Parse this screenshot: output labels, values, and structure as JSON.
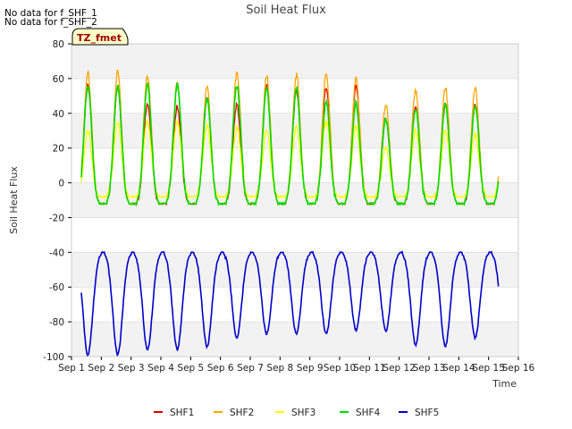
{
  "notes": [
    "No data for f_SHF_1",
    "No data for f_SHF_2"
  ],
  "badge": "TZ_fmet",
  "chart_data": {
    "type": "line",
    "title": "Soil Heat Flux",
    "xlabel": "Time",
    "ylabel": "Soil Heat Flux",
    "xlim": [
      1,
      16
    ],
    "ylim": [
      -100,
      80
    ],
    "x_ticks": [
      1,
      2,
      3,
      4,
      5,
      6,
      7,
      8,
      9,
      10,
      11,
      12,
      13,
      14,
      15,
      16
    ],
    "x_tick_labels": [
      "Sep 1",
      "Sep 2",
      "Sep 3",
      "Sep 4",
      "Sep 5",
      "Sep 6",
      "Sep 7",
      "Sep 8",
      "Sep 9",
      "Sep 10",
      "Sep 11",
      "Sep 12",
      "Sep 13",
      "Sep 14",
      "Sep 15",
      "Sep 16"
    ],
    "y_ticks": [
      -100,
      -80,
      -60,
      -40,
      -20,
      0,
      20,
      40,
      60,
      80
    ],
    "grid": "horizontal bands",
    "legend_position": "bottom",
    "series_start": 1.33,
    "series_end": 15.33,
    "daily_peak_offset": 0.55,
    "series": [
      {
        "name": "SHF1",
        "color": "#dd0000",
        "base": -12,
        "peaks": [
          56,
          55,
          45,
          44,
          48,
          45,
          56,
          53,
          55,
          56,
          37,
          45,
          45,
          45
        ]
      },
      {
        "name": "SHF2",
        "color": "#ffa500",
        "base": -12,
        "peaks": [
          63,
          64,
          62,
          59,
          55,
          63,
          62,
          62,
          63,
          60,
          45,
          53,
          55,
          54
        ]
      },
      {
        "name": "SHF3",
        "color": "#ffff00",
        "base": -8,
        "peaks": [
          30,
          35,
          35,
          35,
          33,
          32,
          30,
          32,
          35,
          32,
          20,
          30,
          30,
          28
        ]
      },
      {
        "name": "SHF4",
        "color": "#00dd00",
        "base": -12,
        "peaks": [
          56,
          56,
          56,
          56,
          49,
          56,
          54,
          54,
          47,
          46,
          37,
          43,
          45,
          45
        ]
      },
      {
        "name": "SHF5",
        "color": "#0000cc",
        "base": -40,
        "troughs": [
          -99,
          -99,
          -96,
          -96,
          -94,
          -89,
          -87,
          -87,
          -87,
          -85,
          -85,
          -93,
          -94,
          -89
        ]
      }
    ]
  }
}
